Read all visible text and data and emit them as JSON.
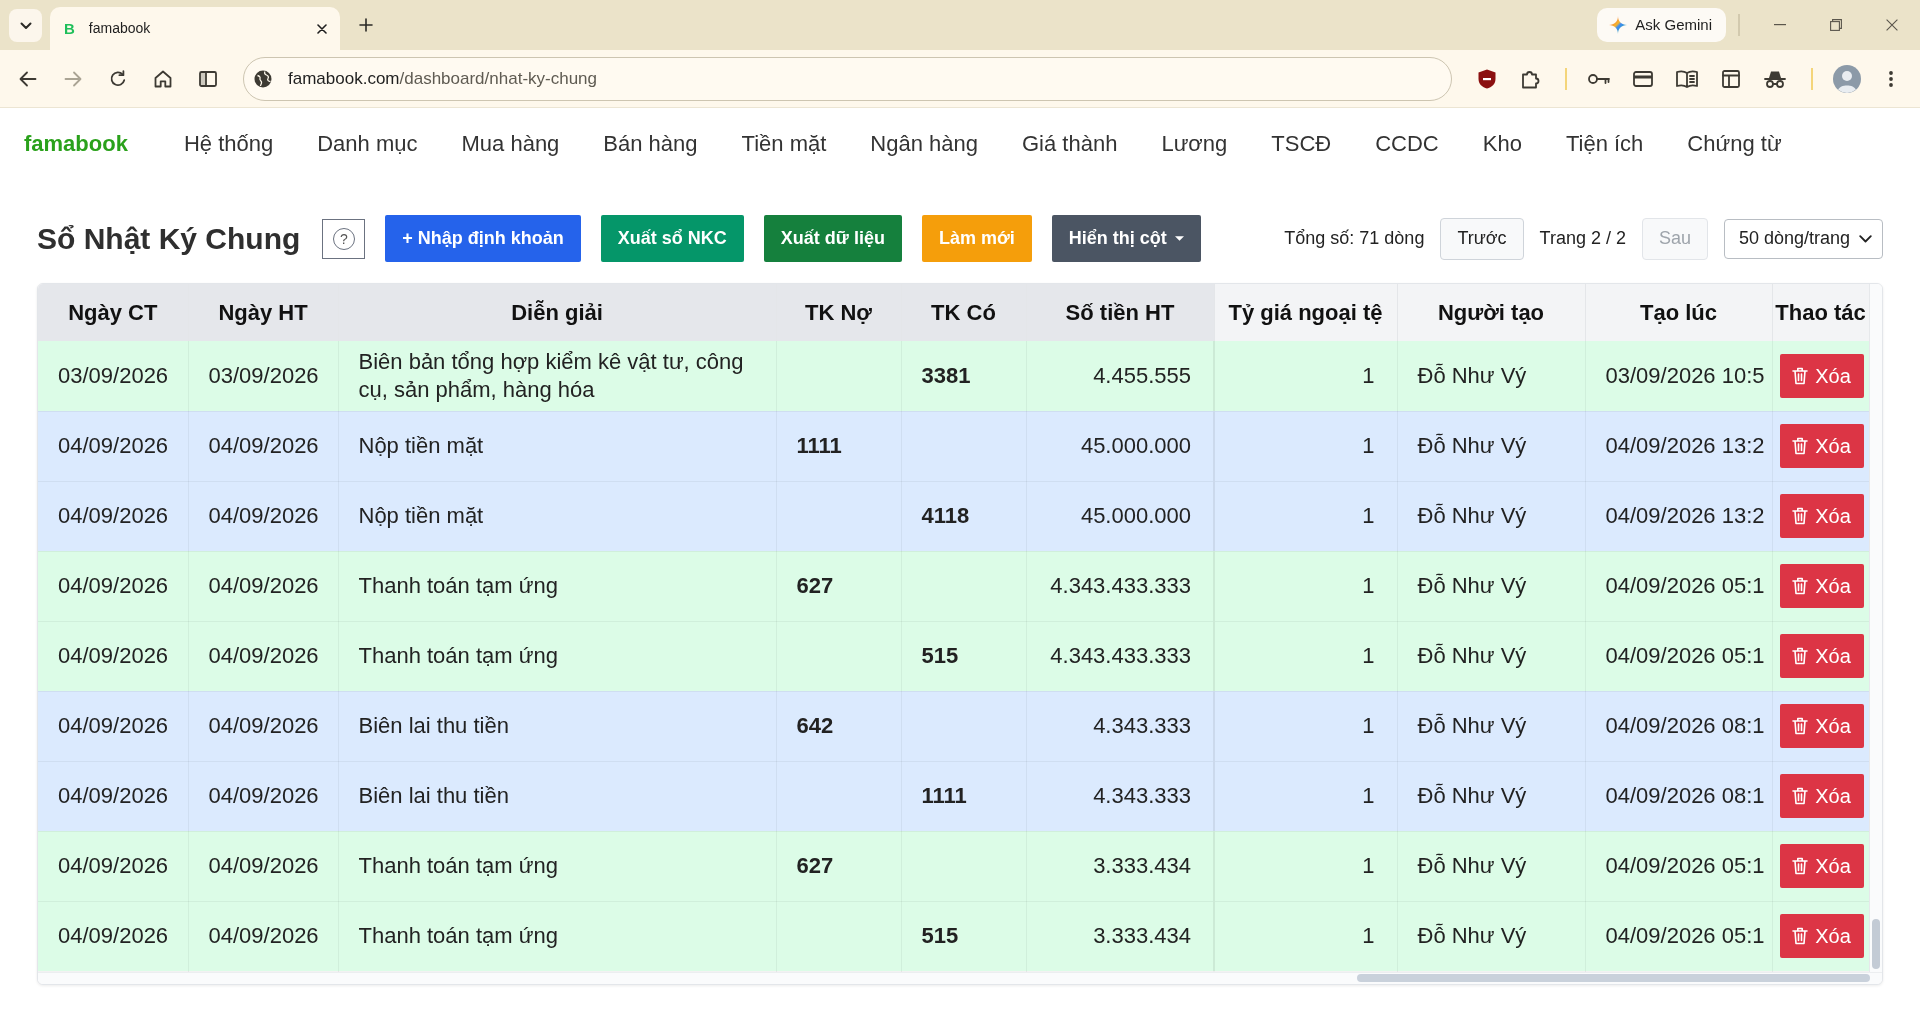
{
  "browser": {
    "tab": {
      "favicon": "B",
      "title": "famabook",
      "selected": true
    },
    "gemini_button": "Ask Gemini",
    "url": "famabook.com/dashboard/nhat-ky-chung"
  },
  "navbar": {
    "brand": "famabook",
    "items": [
      "Hệ thống",
      "Danh mục",
      "Mua hàng",
      "Bán hàng",
      "Tiền mặt",
      "Ngân hàng",
      "Giá thành",
      "Lương",
      "TSCĐ",
      "CCDC",
      "Kho",
      "Tiện ích",
      "Chứng từ"
    ]
  },
  "page": {
    "title": "Sổ Nhật Ký Chung",
    "help_icon": "?",
    "actions": [
      {
        "label": "+ Nhập định khoản",
        "kind": "button",
        "color": "#2563eb"
      },
      {
        "label": "Xuất sổ NKC",
        "kind": "button",
        "color": "#059669"
      },
      {
        "label": "Xuất dữ liệu",
        "kind": "button",
        "color": "#15803d"
      },
      {
        "label": "Làm mới",
        "kind": "button",
        "color": "#f59e0b"
      },
      {
        "label": "Hiển thị cột",
        "kind": "dropdown",
        "color": "#4b5563"
      }
    ]
  },
  "pagination": {
    "total": "Tổng số: 71 dòng",
    "prev": {
      "label": "Trước",
      "disabled": false
    },
    "page": "Trang 2 / 2",
    "next": {
      "label": "Sau",
      "disabled": true
    },
    "page_size": "50 dòng/trang"
  },
  "table": {
    "columns": [
      "Ngày CT",
      "Ngày HT",
      "Diễn giải",
      "TK Nợ",
      "TK Có",
      "Số tiền HT",
      "Tỷ giá ngoại tệ",
      "Người tạo",
      "Tạo lúc",
      "Thao tác"
    ],
    "rows": [
      {
        "color": "#dcfce7",
        "date_ct": "03/09/2026",
        "date_ht": "03/09/2026",
        "description": "Biên bản tổng hợp kiểm kê vật tư, công cụ, sản phẩm, hàng hóa",
        "credit_account": "3381",
        "amount": "4.455.555",
        "exchange_rate": "1",
        "created_by": "Đỗ Như Vý",
        "created_at": "03/09/2026 10:5",
        "action": "Xóa"
      },
      {
        "color": "#dbeafe",
        "date_ct": "04/09/2026",
        "date_ht": "04/09/2026",
        "description": "Nộp tiền mặt",
        "debit_account": "1111",
        "amount": "45.000.000",
        "exchange_rate": "1",
        "created_by": "Đỗ Như Vý",
        "created_at": "04/09/2026 13:2",
        "action": "Xóa"
      },
      {
        "color": "#dbeafe",
        "date_ct": "04/09/2026",
        "date_ht": "04/09/2026",
        "description": "Nộp tiền mặt",
        "credit_account": "4118",
        "amount": "45.000.000",
        "exchange_rate": "1",
        "created_by": "Đỗ Như Vý",
        "created_at": "04/09/2026 13:2",
        "action": "Xóa"
      },
      {
        "color": "#dcfce7",
        "date_ct": "04/09/2026",
        "date_ht": "04/09/2026",
        "description": "Thanh toán tạm ứng",
        "debit_account": "627",
        "amount": "4.343.433.333",
        "exchange_rate": "1",
        "created_by": "Đỗ Như Vý",
        "created_at": "04/09/2026 05:1",
        "action": "Xóa"
      },
      {
        "color": "#dcfce7",
        "date_ct": "04/09/2026",
        "date_ht": "04/09/2026",
        "description": "Thanh toán tạm ứng",
        "credit_account": "515",
        "amount": "4.343.433.333",
        "exchange_rate": "1",
        "created_by": "Đỗ Như Vý",
        "created_at": "04/09/2026 05:1",
        "action": "Xóa"
      },
      {
        "color": "#dbeafe",
        "date_ct": "04/09/2026",
        "date_ht": "04/09/2026",
        "description": "Biên lai thu tiền",
        "debit_account": "642",
        "amount": "4.343.333",
        "exchange_rate": "1",
        "created_by": "Đỗ Như Vý",
        "created_at": "04/09/2026 08:1",
        "action": "Xóa"
      },
      {
        "color": "#dbeafe",
        "date_ct": "04/09/2026",
        "date_ht": "04/09/2026",
        "description": "Biên lai thu tiền",
        "credit_account": "1111",
        "amount": "4.343.333",
        "exchange_rate": "1",
        "created_by": "Đỗ Như Vý",
        "created_at": "04/09/2026 08:1",
        "action": "Xóa"
      },
      {
        "color": "#dcfce7",
        "date_ct": "04/09/2026",
        "date_ht": "04/09/2026",
        "description": "Thanh toán tạm ứng",
        "debit_account": "627",
        "amount": "3.333.434",
        "exchange_rate": "1",
        "created_by": "Đỗ Như Vý",
        "created_at": "04/09/2026 05:1",
        "action": "Xóa"
      },
      {
        "color": "#dcfce7",
        "date_ct": "04/09/2026",
        "date_ht": "04/09/2026",
        "description": "Thanh toán tạm ứng",
        "credit_account": "515",
        "amount": "3.333.434",
        "exchange_rate": "1",
        "created_by": "Đỗ Như Vý",
        "created_at": "04/09/2026 05:1",
        "action": "Xóa"
      }
    ]
  }
}
